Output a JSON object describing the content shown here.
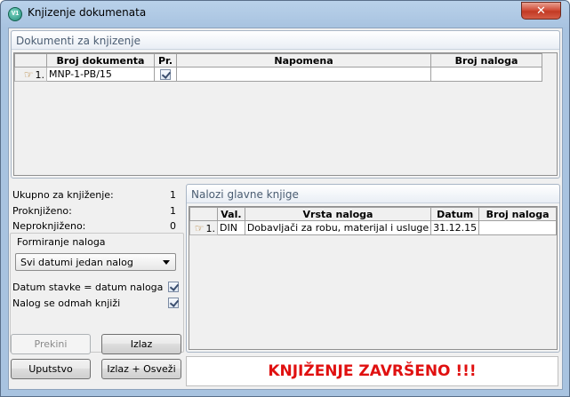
{
  "window": {
    "title": "Knjizenje dokumenata",
    "app_icon_text": "V1",
    "close_glyph": "✕"
  },
  "documents": {
    "title": "Dokumenti za knjizenje",
    "columns": [
      "Broj dokumenta",
      "Pr.",
      "Napomena",
      "Broj naloga"
    ],
    "rows": [
      {
        "num": "1.",
        "broj_dokumenta": "MNP-1-PB/15",
        "proknjizen": true,
        "napomena": "",
        "broj_naloga": ""
      }
    ]
  },
  "summary": {
    "ukupno_label": "Ukupno za knjiženje:",
    "ukupno_value": "1",
    "proknjizeno_label": "Proknjiženo:",
    "proknjizeno_value": "1",
    "neproknjizeno_label": "Neproknjiženo:",
    "neproknjizeno_value": "0"
  },
  "formiranje": {
    "title": "Formiranje naloga",
    "select_value": "Svi datumi jedan nalog",
    "opt1_label": "Datum stavke = datum naloga",
    "opt1_checked": true,
    "opt2_label": "Nalog se odmah knjiži",
    "opt2_checked": true
  },
  "nalozi": {
    "title": "Nalozi glavne knjige",
    "columns": [
      "Val.",
      "Vrsta naloga",
      "Datum",
      "Broj naloga"
    ],
    "rows": [
      {
        "num": "1.",
        "val": "DIN",
        "vrsta": "Dobavljači za robu, materijal i usluge",
        "datum": "31.12.15",
        "broj_naloga": ""
      }
    ]
  },
  "buttons": {
    "prekini": "Prekini",
    "izlaz": "Izlaz",
    "uputstvo": "Uputstvo",
    "izlaz_osvezi": "Izlaz + Osveži"
  },
  "status": "KNJIŽENJE ZAVRŠENO !!!",
  "colors": {
    "status_text": "#e01010",
    "title_bar": "#a8c3e0"
  },
  "icons": {
    "row_pointer": "pointing-hand-icon",
    "close": "close-icon",
    "app": "app-icon"
  }
}
